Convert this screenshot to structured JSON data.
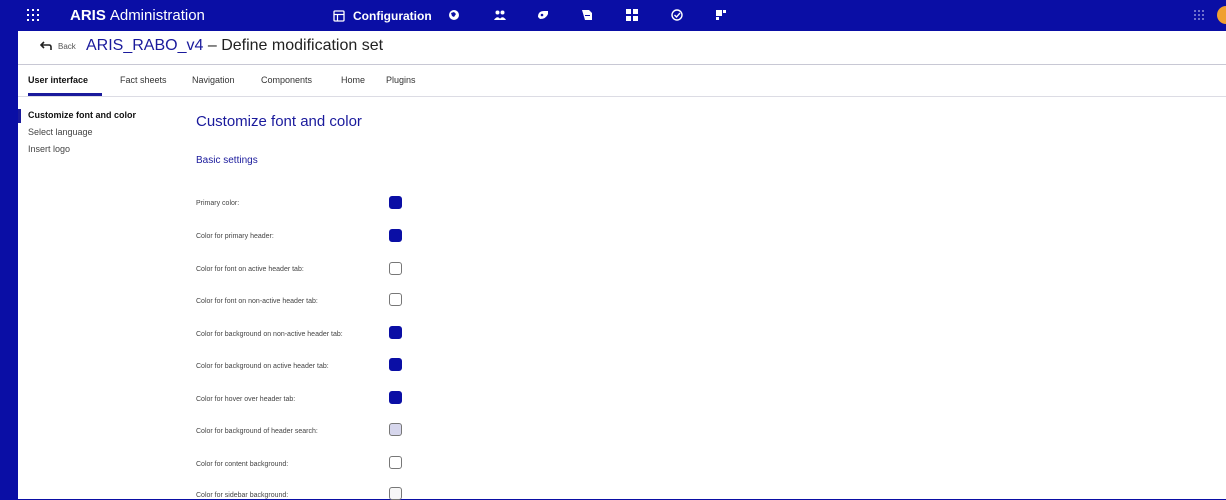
{
  "topbar": {
    "app_bold": "ARIS",
    "app_name": "Administration",
    "active_nav": "Configuration",
    "nav_icons": [
      "globe-icon",
      "users-icon",
      "key-icon",
      "document-icon",
      "dashboard-icon",
      "check-icon",
      "layout-icon"
    ],
    "right_icons": [
      "apps-icon",
      "avatar-icon"
    ]
  },
  "subheader": {
    "back_label": "Back",
    "title_name": "ARIS_RABO_v4",
    "title_suffix": "– Define modification set"
  },
  "tabs": [
    "User interface",
    "Fact sheets",
    "Navigation",
    "Components",
    "Home",
    "Plugins"
  ],
  "active_tab": "User interface",
  "sidenav": {
    "items": [
      "Customize font and color",
      "Select language",
      "Insert logo"
    ],
    "active": "Customize font and color"
  },
  "content": {
    "title": "Customize font and color",
    "section": "Basic settings",
    "rows": [
      {
        "label": "Primary color:",
        "color": "#0a0ea5"
      },
      {
        "label": "Color for primary header:",
        "color": "#0a0ea5"
      },
      {
        "label": "Color for font on active header tab:",
        "color": "#ffffff"
      },
      {
        "label": "Color for font on non-active header tab:",
        "color": "#ffffff"
      },
      {
        "label": "Color for background on non-active header tab:",
        "color": "#0a0ea5"
      },
      {
        "label": "Color for background on active header tab:",
        "color": "#0a0ea5"
      },
      {
        "label": "Color for hover over header tab:",
        "color": "#0a0ea5"
      },
      {
        "label": "Color for background of header search:",
        "color": "#d6d6ec"
      },
      {
        "label": "Color for content background:",
        "color": "#ffffff"
      },
      {
        "label": "Color for sidebar background:",
        "color": "#f7f7f7"
      }
    ]
  },
  "colors": {
    "primary": "#0a0ea5",
    "accent_text": "#1a1a9c"
  }
}
